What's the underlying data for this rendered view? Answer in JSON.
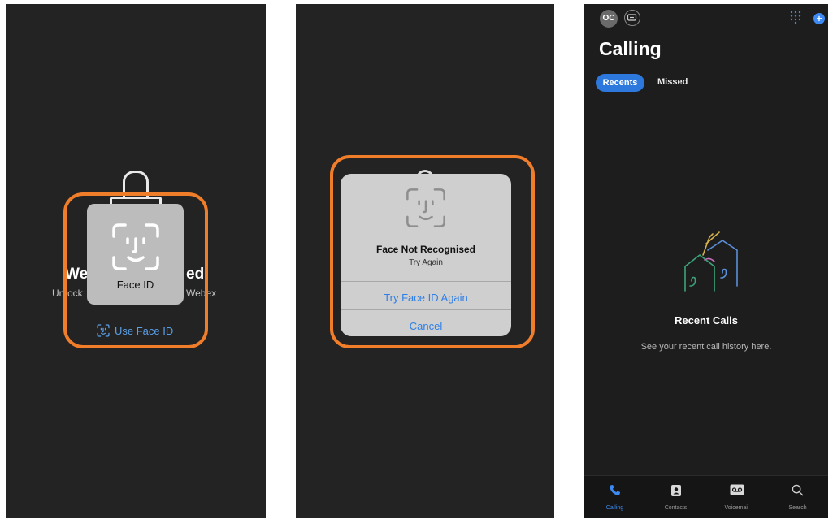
{
  "panel1": {
    "bg_title_left": "We",
    "bg_title_right": "ed",
    "bg_sub_left": "Un",
    "bg_sub_mid": "ock",
    "bg_sub_right": "Webex",
    "faceid_card_label": "Face ID",
    "use_face_id_label": "Use Face ID"
  },
  "panel2": {
    "alert_title": "Face Not Recognised",
    "alert_message": "Try Again",
    "primary_button": "Try Face ID Again",
    "cancel_button": "Cancel"
  },
  "panel3": {
    "avatar_initials": "OC",
    "title": "Calling",
    "tabs": [
      {
        "label": "Recents",
        "active": true
      },
      {
        "label": "Missed",
        "active": false
      }
    ],
    "empty_state": {
      "title": "Recent Calls",
      "subtitle": "See your recent call history here."
    },
    "bottom_nav": [
      {
        "label": "Calling",
        "icon": "phone-icon",
        "active": true
      },
      {
        "label": "Contacts",
        "icon": "contacts-icon",
        "active": false
      },
      {
        "label": "Voicemail",
        "icon": "voicemail-icon",
        "active": false
      },
      {
        "label": "Search",
        "icon": "search-icon",
        "active": false
      }
    ]
  },
  "colors": {
    "highlight_ring": "#ef7d2a",
    "accent_blue": "#2c78dc",
    "background": "#232323"
  }
}
